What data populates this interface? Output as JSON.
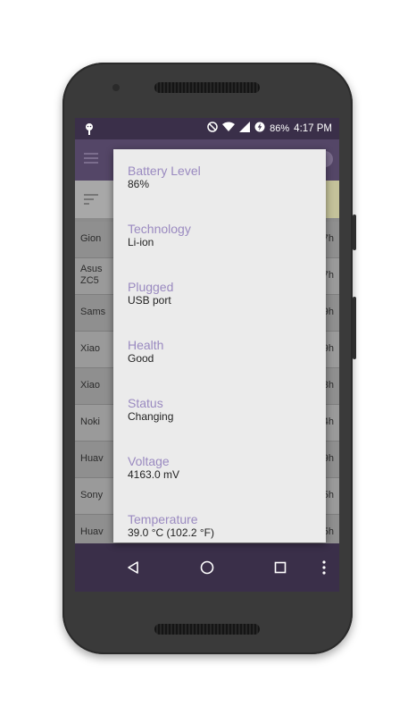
{
  "status_bar": {
    "battery_percent": "86%",
    "time": "4:17 PM"
  },
  "background_list": {
    "rows": [
      {
        "left": "Gion",
        "right": "7h"
      },
      {
        "left": "Asus\nZC5",
        "right": "7h"
      },
      {
        "left": "Sams",
        "right": "9h"
      },
      {
        "left": "Xiao",
        "right": "9h"
      },
      {
        "left": "Xiao",
        "right": "3h"
      },
      {
        "left": "Noki",
        "right": "4h"
      },
      {
        "left": "Huav",
        "right": "9h"
      },
      {
        "left": "Sony",
        "right": "5h"
      },
      {
        "left": "Huav",
        "right": "5h"
      }
    ]
  },
  "dialog": {
    "items": [
      {
        "label": "Battery Level",
        "value": "86%"
      },
      {
        "label": "Technology",
        "value": "Li-ion"
      },
      {
        "label": "Plugged",
        "value": "USB port"
      },
      {
        "label": "Health",
        "value": "Good"
      },
      {
        "label": "Status",
        "value": "Changing"
      },
      {
        "label": "Voltage",
        "value": "4163.0 mV"
      },
      {
        "label": "Temperature",
        "value": "39.0 °C (102.2 °F)"
      }
    ]
  },
  "icons": {
    "status_left": "android-debug-icon",
    "dnd": "do-not-disturb-icon",
    "wifi": "wifi-icon",
    "signal": "cell-signal-icon",
    "battery": "battery-charging-icon",
    "menu": "hamburger-menu-icon",
    "info": "info-icon",
    "sort": "sort-icon",
    "back": "back-triangle-icon",
    "home": "home-circle-icon",
    "recents": "recents-square-icon",
    "overflow": "more-vert-icon"
  },
  "colors": {
    "status_bar": "#3a2f49",
    "app_bar": "#544667",
    "dialog_label": "#9a8ac0",
    "dialog_bg": "#ebebeb"
  }
}
